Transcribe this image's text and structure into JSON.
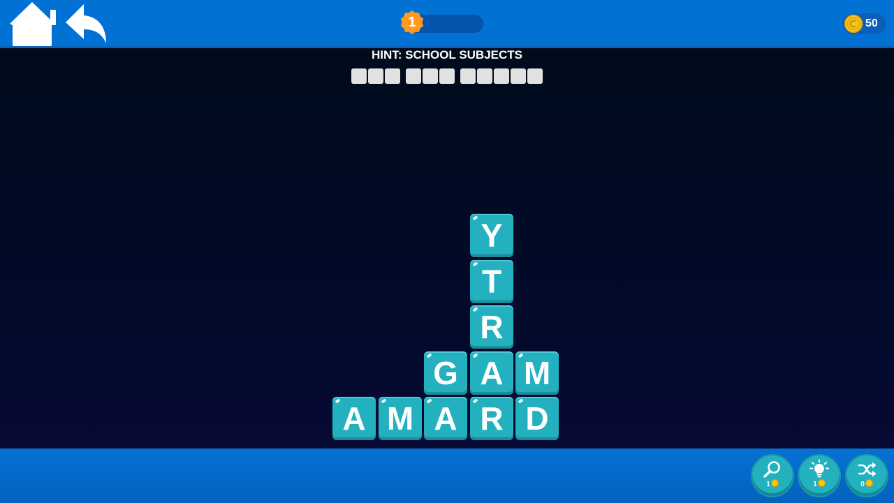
{
  "header": {
    "home_icon": "home-icon",
    "back_icon": "back-arrow-icon",
    "level": {
      "number": "1",
      "progress": 0.0
    },
    "coins": {
      "icon": "coin-icon",
      "count": "50"
    }
  },
  "hint": {
    "text": "HINT: SCHOOL SUBJECTS",
    "answer_words": [
      {
        "length": 3
      },
      {
        "length": 3
      },
      {
        "length": 5
      }
    ]
  },
  "board": {
    "columns": [
      {
        "col": 0,
        "letters_bottom_up": [
          "A"
        ]
      },
      {
        "col": 1,
        "letters_bottom_up": [
          "M"
        ]
      },
      {
        "col": 2,
        "letters_bottom_up": [
          "A",
          "G"
        ]
      },
      {
        "col": 3,
        "letters_bottom_up": [
          "R",
          "A",
          "R",
          "T",
          "Y"
        ]
      },
      {
        "col": 4,
        "letters_bottom_up": [
          "D",
          "M"
        ]
      }
    ]
  },
  "powerups": [
    {
      "id": "search",
      "icon": "magnifier-icon",
      "cost": "1"
    },
    {
      "id": "hint",
      "icon": "lightbulb-icon",
      "cost": "1"
    },
    {
      "id": "shuffle",
      "icon": "shuffle-icon",
      "cost": "0"
    }
  ],
  "colors": {
    "bar_blue": "#0271d4",
    "board_dark": "#000d1d",
    "tile_teal": "#23b1bf",
    "level_orange": "#ff9a1f",
    "coin_gold": "#f5c518"
  }
}
